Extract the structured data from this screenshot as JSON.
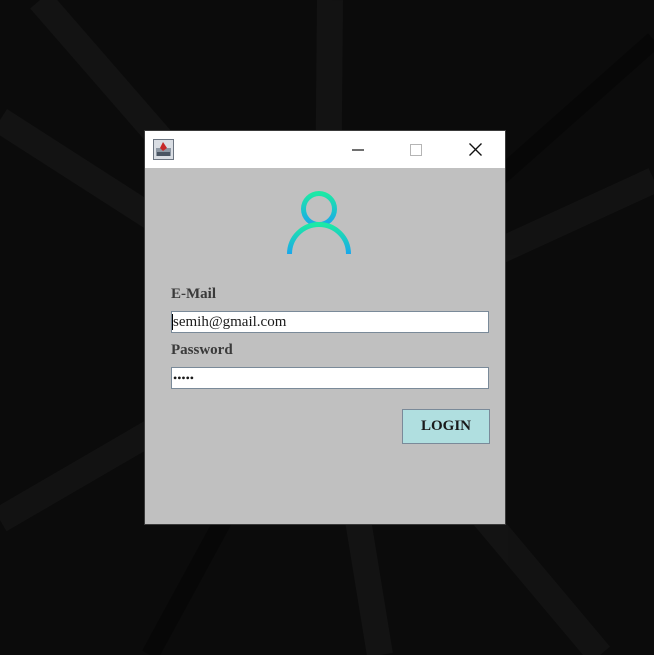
{
  "desktop": {
    "background_color": "#0b0b0b"
  },
  "window": {
    "title": "",
    "app_icon": "java-app-icon",
    "controls": {
      "minimize_icon": "minimize-icon",
      "maximize_icon": "maximize-icon",
      "close_icon": "close-icon"
    },
    "background_color": "#c0c0c0"
  },
  "login_form": {
    "avatar_icon": "user-icon",
    "avatar_gradient": [
      "#1de9a5",
      "#1aa7ec"
    ],
    "email_label": "E-Mail",
    "email_value": "semih@gmail.com",
    "password_label": "Password",
    "password_value": "•••••",
    "login_label": "LOGIN",
    "login_button_color": "#b0dfe0"
  }
}
